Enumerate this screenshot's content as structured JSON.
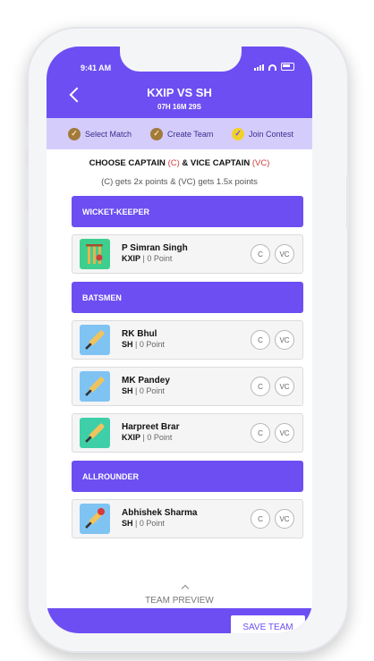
{
  "status": {
    "time": "9:41 AM"
  },
  "header": {
    "title": "KXIP VS SH",
    "timer": "07H 16M 29S"
  },
  "steps": [
    {
      "label": "Select Match",
      "state": "done"
    },
    {
      "label": "Create Team",
      "state": "done"
    },
    {
      "label": "Join Contest",
      "state": "active"
    }
  ],
  "heading": {
    "prefix": "CHOOSE CAPTAIN",
    "c_tag": "(C)",
    "mid": "& VICE CAPTAIN",
    "vc_tag": "(VC)",
    "subtitle": "(C) gets 2x points & (VC) gets 1.5x points"
  },
  "sections": [
    {
      "title": "WICKET-KEEPER"
    },
    {
      "title": "BATSMEN"
    },
    {
      "title": "ALLROUNDER"
    }
  ],
  "players": [
    {
      "name": "P Simran Singh",
      "team": "KXIP",
      "points": "| 0 Point",
      "icon": "wickets-icon"
    },
    {
      "name": "RK Bhul",
      "team": "SH",
      "points": "| 0 Point",
      "icon": "cricket-bat-icon"
    },
    {
      "name": "MK Pandey",
      "team": "SH",
      "points": "| 0 Point",
      "icon": "cricket-bat-icon"
    },
    {
      "name": "Harpreet Brar",
      "team": "KXIP",
      "points": "| 0 Point",
      "icon": "cricket-bat-icon"
    },
    {
      "name": "Abhishek Sharma",
      "team": "SH",
      "points": "| 0 Point",
      "icon": "bat-and-ball-icon"
    }
  ],
  "choice": {
    "c": "C",
    "vc": "VC"
  },
  "footer": {
    "preview_label": "TEAM PREVIEW",
    "save_label": "SAVE TEAM"
  },
  "colors": {
    "primary": "#6c4ef2",
    "steps_bg": "#d4cdfc",
    "captain_tag": "#d13b3b"
  }
}
